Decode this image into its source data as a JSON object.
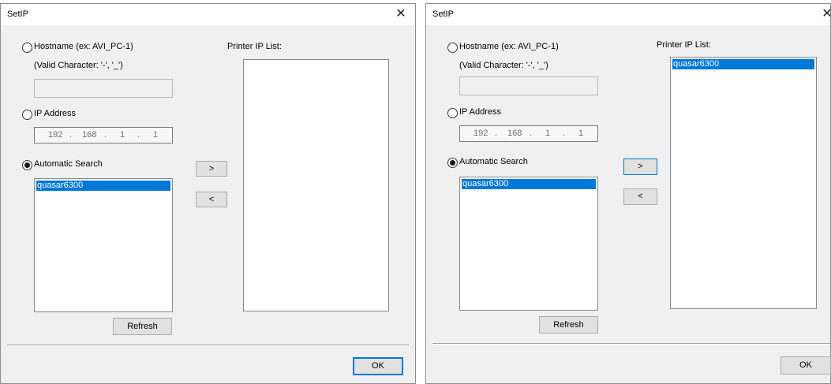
{
  "dialogs": [
    {
      "title": "SetIP",
      "hostname_label": "Hostname (ex: AVI_PC-1)",
      "valid_chars_label": "(Valid Character: '-', '_')",
      "hostname_value": "",
      "ip_label": "IP Address",
      "ip": [
        "192",
        "168",
        "1",
        "1"
      ],
      "ip_dots": [
        ".",
        ".",
        "."
      ],
      "auto_label": "Automatic Search",
      "selected_mode": "Automatic Search",
      "search_results": [
        "quasar6300"
      ],
      "refresh_label": "Refresh",
      "add_label": ">",
      "remove_label": "<",
      "printer_list_label": "Printer IP List:",
      "printer_list": [],
      "ok_label": "OK"
    },
    {
      "title": "SetIP",
      "hostname_label": "Hostname (ex: AVI_PC-1)",
      "valid_chars_label": "(Valid Character: '-', '_')",
      "hostname_value": "",
      "ip_label": "IP Address",
      "ip": [
        "192",
        "168",
        "1",
        "1"
      ],
      "ip_dots": [
        ".",
        ".",
        "."
      ],
      "auto_label": "Automatic Search",
      "selected_mode": "Automatic Search",
      "search_results": [
        "quasar6300"
      ],
      "refresh_label": "Refresh",
      "add_label": ">",
      "remove_label": "<",
      "printer_list_label": "Printer IP List:",
      "printer_list": [
        "quasar6300"
      ],
      "ok_label": "OK"
    }
  ],
  "icons": {
    "close": "close-icon",
    "radio": "radio-button"
  },
  "colors": {
    "selection": "#0078d7",
    "dialog_bg": "#f0f0f0",
    "focus_border": "#0078d7"
  }
}
